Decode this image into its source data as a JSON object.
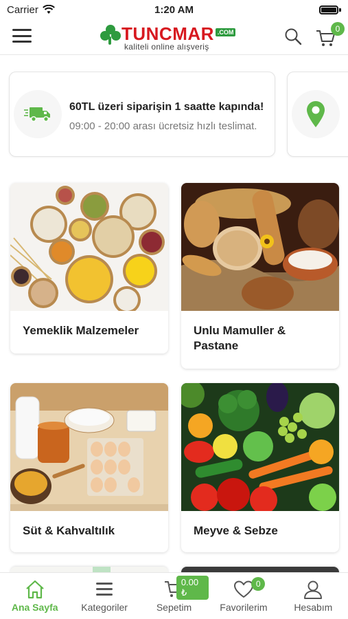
{
  "status": {
    "carrier": "Carrier",
    "time": "1:20 AM"
  },
  "header": {
    "logo_text": "TUNCMAR",
    "logo_com": ".COM",
    "logo_tagline": "kaliteli online alışveriş",
    "cart_count": "0"
  },
  "promos": [
    {
      "title": "60TL üzeri siparişin 1 saatte kapında!",
      "subtitle": "09:00 - 20:00 arası ücretsiz hızlı teslimat.",
      "icon": "delivery-truck-icon"
    },
    {
      "title": "",
      "subtitle": "",
      "icon": "location-pin-icon"
    }
  ],
  "categories": [
    {
      "label": "Yemeklik Malzemeler",
      "image": "grains-pasta-photo"
    },
    {
      "label": "Unlu Mamuller & Pastane",
      "image": "bread-bakery-photo"
    },
    {
      "label": "Süt & Kahvaltılık",
      "image": "milk-breakfast-photo"
    },
    {
      "label": "Meyve & Sebze",
      "image": "fruit-vegetables-photo"
    }
  ],
  "tabbar": {
    "items": [
      {
        "label": "Ana Sayfa",
        "icon": "home-icon",
        "active": true
      },
      {
        "label": "Kategoriler",
        "icon": "list-icon"
      },
      {
        "label": "Sepetim",
        "icon": "cart-icon",
        "price": "0.00 ₺"
      },
      {
        "label": "Favorilerim",
        "icon": "heart-icon",
        "count": "0"
      },
      {
        "label": "Hesabım",
        "icon": "user-icon"
      }
    ]
  },
  "colors": {
    "accent_green": "#5fb84a",
    "logo_red": "#d71920",
    "logo_green": "#2e9b3f"
  }
}
